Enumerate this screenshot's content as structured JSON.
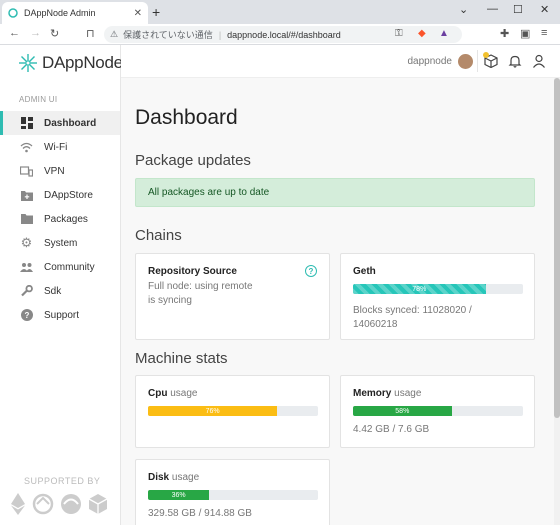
{
  "browser": {
    "tab_title": "DAppNode Admin",
    "security_text": "保護されていない通信",
    "url": "dappnode.local/#/dashboard"
  },
  "sidebar": {
    "logo_text": "DAppNode",
    "section_label": "ADMIN UI",
    "items": [
      {
        "label": "Dashboard",
        "icon": "dashboard-icon"
      },
      {
        "label": "Wi-Fi",
        "icon": "wifi-icon"
      },
      {
        "label": "VPN",
        "icon": "devices-icon"
      },
      {
        "label": "DAppStore",
        "icon": "store-icon"
      },
      {
        "label": "Packages",
        "icon": "folder-icon"
      },
      {
        "label": "System",
        "icon": "gear-icon"
      },
      {
        "label": "Community",
        "icon": "people-icon"
      },
      {
        "label": "Sdk",
        "icon": "wrench-icon"
      },
      {
        "label": "Support",
        "icon": "help-icon"
      }
    ],
    "supported_by": "SUPPORTED BY"
  },
  "header": {
    "username": "dappnode"
  },
  "main": {
    "title": "Dashboard",
    "package_updates": {
      "heading": "Package updates",
      "message": "All packages are up to date"
    },
    "chains": {
      "heading": "Chains",
      "cards": [
        {
          "title": "Repository Source",
          "line1": "Full node: using remote",
          "line2": "is syncing"
        },
        {
          "title": "Geth",
          "progress_label": "78%",
          "progress": 78,
          "line1": "Blocks synced: 11028020 /",
          "line2": "14060218"
        }
      ]
    },
    "machine_stats": {
      "heading": "Machine stats",
      "cards": [
        {
          "title": "Cpu",
          "sub": "usage",
          "progress_label": "76%",
          "progress": 76
        },
        {
          "title": "Memory",
          "sub": "usage",
          "progress_label": "58%",
          "progress": 58,
          "detail": "4.42 GB / 7.6 GB"
        },
        {
          "title": "Disk",
          "sub": "usage",
          "progress_label": "36%",
          "progress": 36,
          "detail": "329.58 GB / 914.88 GB"
        }
      ]
    }
  },
  "colors": {
    "accent": "#2fbcb2",
    "success_bg": "#d4edda",
    "cpu_bar": "#fbbd14",
    "ok_bar": "#28a745",
    "sync_bar": "#26c6b9"
  }
}
